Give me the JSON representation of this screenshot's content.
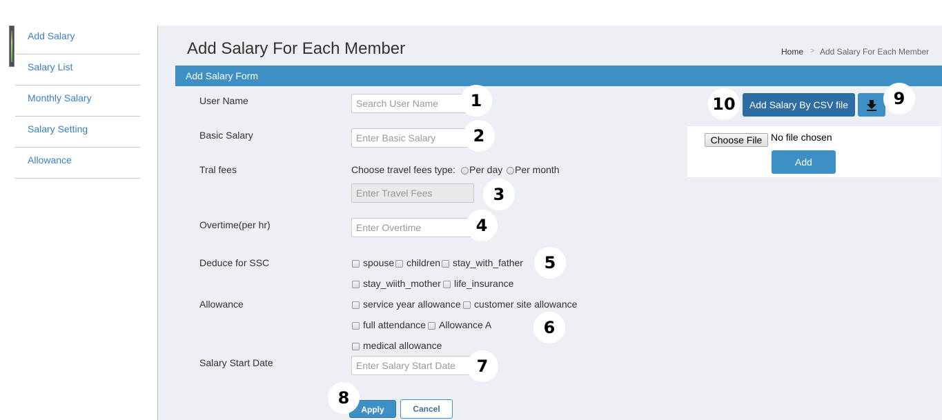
{
  "sidebar": {
    "items": [
      {
        "label": "Add Salary"
      },
      {
        "label": "Salary List"
      },
      {
        "label": "Monthly Salary"
      },
      {
        "label": "Salary Setting"
      },
      {
        "label": "Allowance"
      }
    ]
  },
  "header": {
    "title": "Add Salary For Each Member",
    "breadcrumb": {
      "home": "Home",
      "separator": ">",
      "current": "Add Salary For Each Member"
    }
  },
  "form": {
    "title": "Add Salary Form",
    "user_name": {
      "label": "User Name",
      "placeholder": "Search User Name"
    },
    "basic_salary": {
      "label": "Basic Salary",
      "placeholder": "Enter Basic Salary"
    },
    "travel": {
      "label": "Tral fees",
      "type_prompt": "Choose travel fees type:",
      "options": [
        "Per day",
        "Per month"
      ],
      "placeholder": "Enter Travel Fees"
    },
    "overtime": {
      "label": "Overtime(per hr)",
      "placeholder": "Enter Overtime"
    },
    "ssc": {
      "label": "Deduce for SSC",
      "options": [
        "spouse",
        "children",
        "stay_with_father",
        "stay_wiith_mother",
        "life_insurance"
      ]
    },
    "allowance": {
      "label": "Allowance",
      "options": [
        "service year allowance",
        "customer site allowance",
        "full attendance",
        "Allowance A",
        "medical allowance"
      ]
    },
    "start_date": {
      "label": "Salary Start Date",
      "placeholder": "Enter Salary Start Date"
    },
    "apply_label": "Apply",
    "cancel_label": "Cancel"
  },
  "csv": {
    "button_label": "Add Salary By CSV file",
    "download_icon": "download-icon",
    "choose_file_label": "Choose File",
    "no_file_text": "No file chosen",
    "add_label": "Add"
  },
  "annotations": [
    "1",
    "2",
    "3",
    "4",
    "5",
    "6",
    "7",
    "8",
    "9",
    "10"
  ],
  "colors": {
    "accent": "#3d8fc4",
    "csv_button": "#2e6da4",
    "link": "#3a7fbf",
    "main_bg": "#eceff4"
  }
}
